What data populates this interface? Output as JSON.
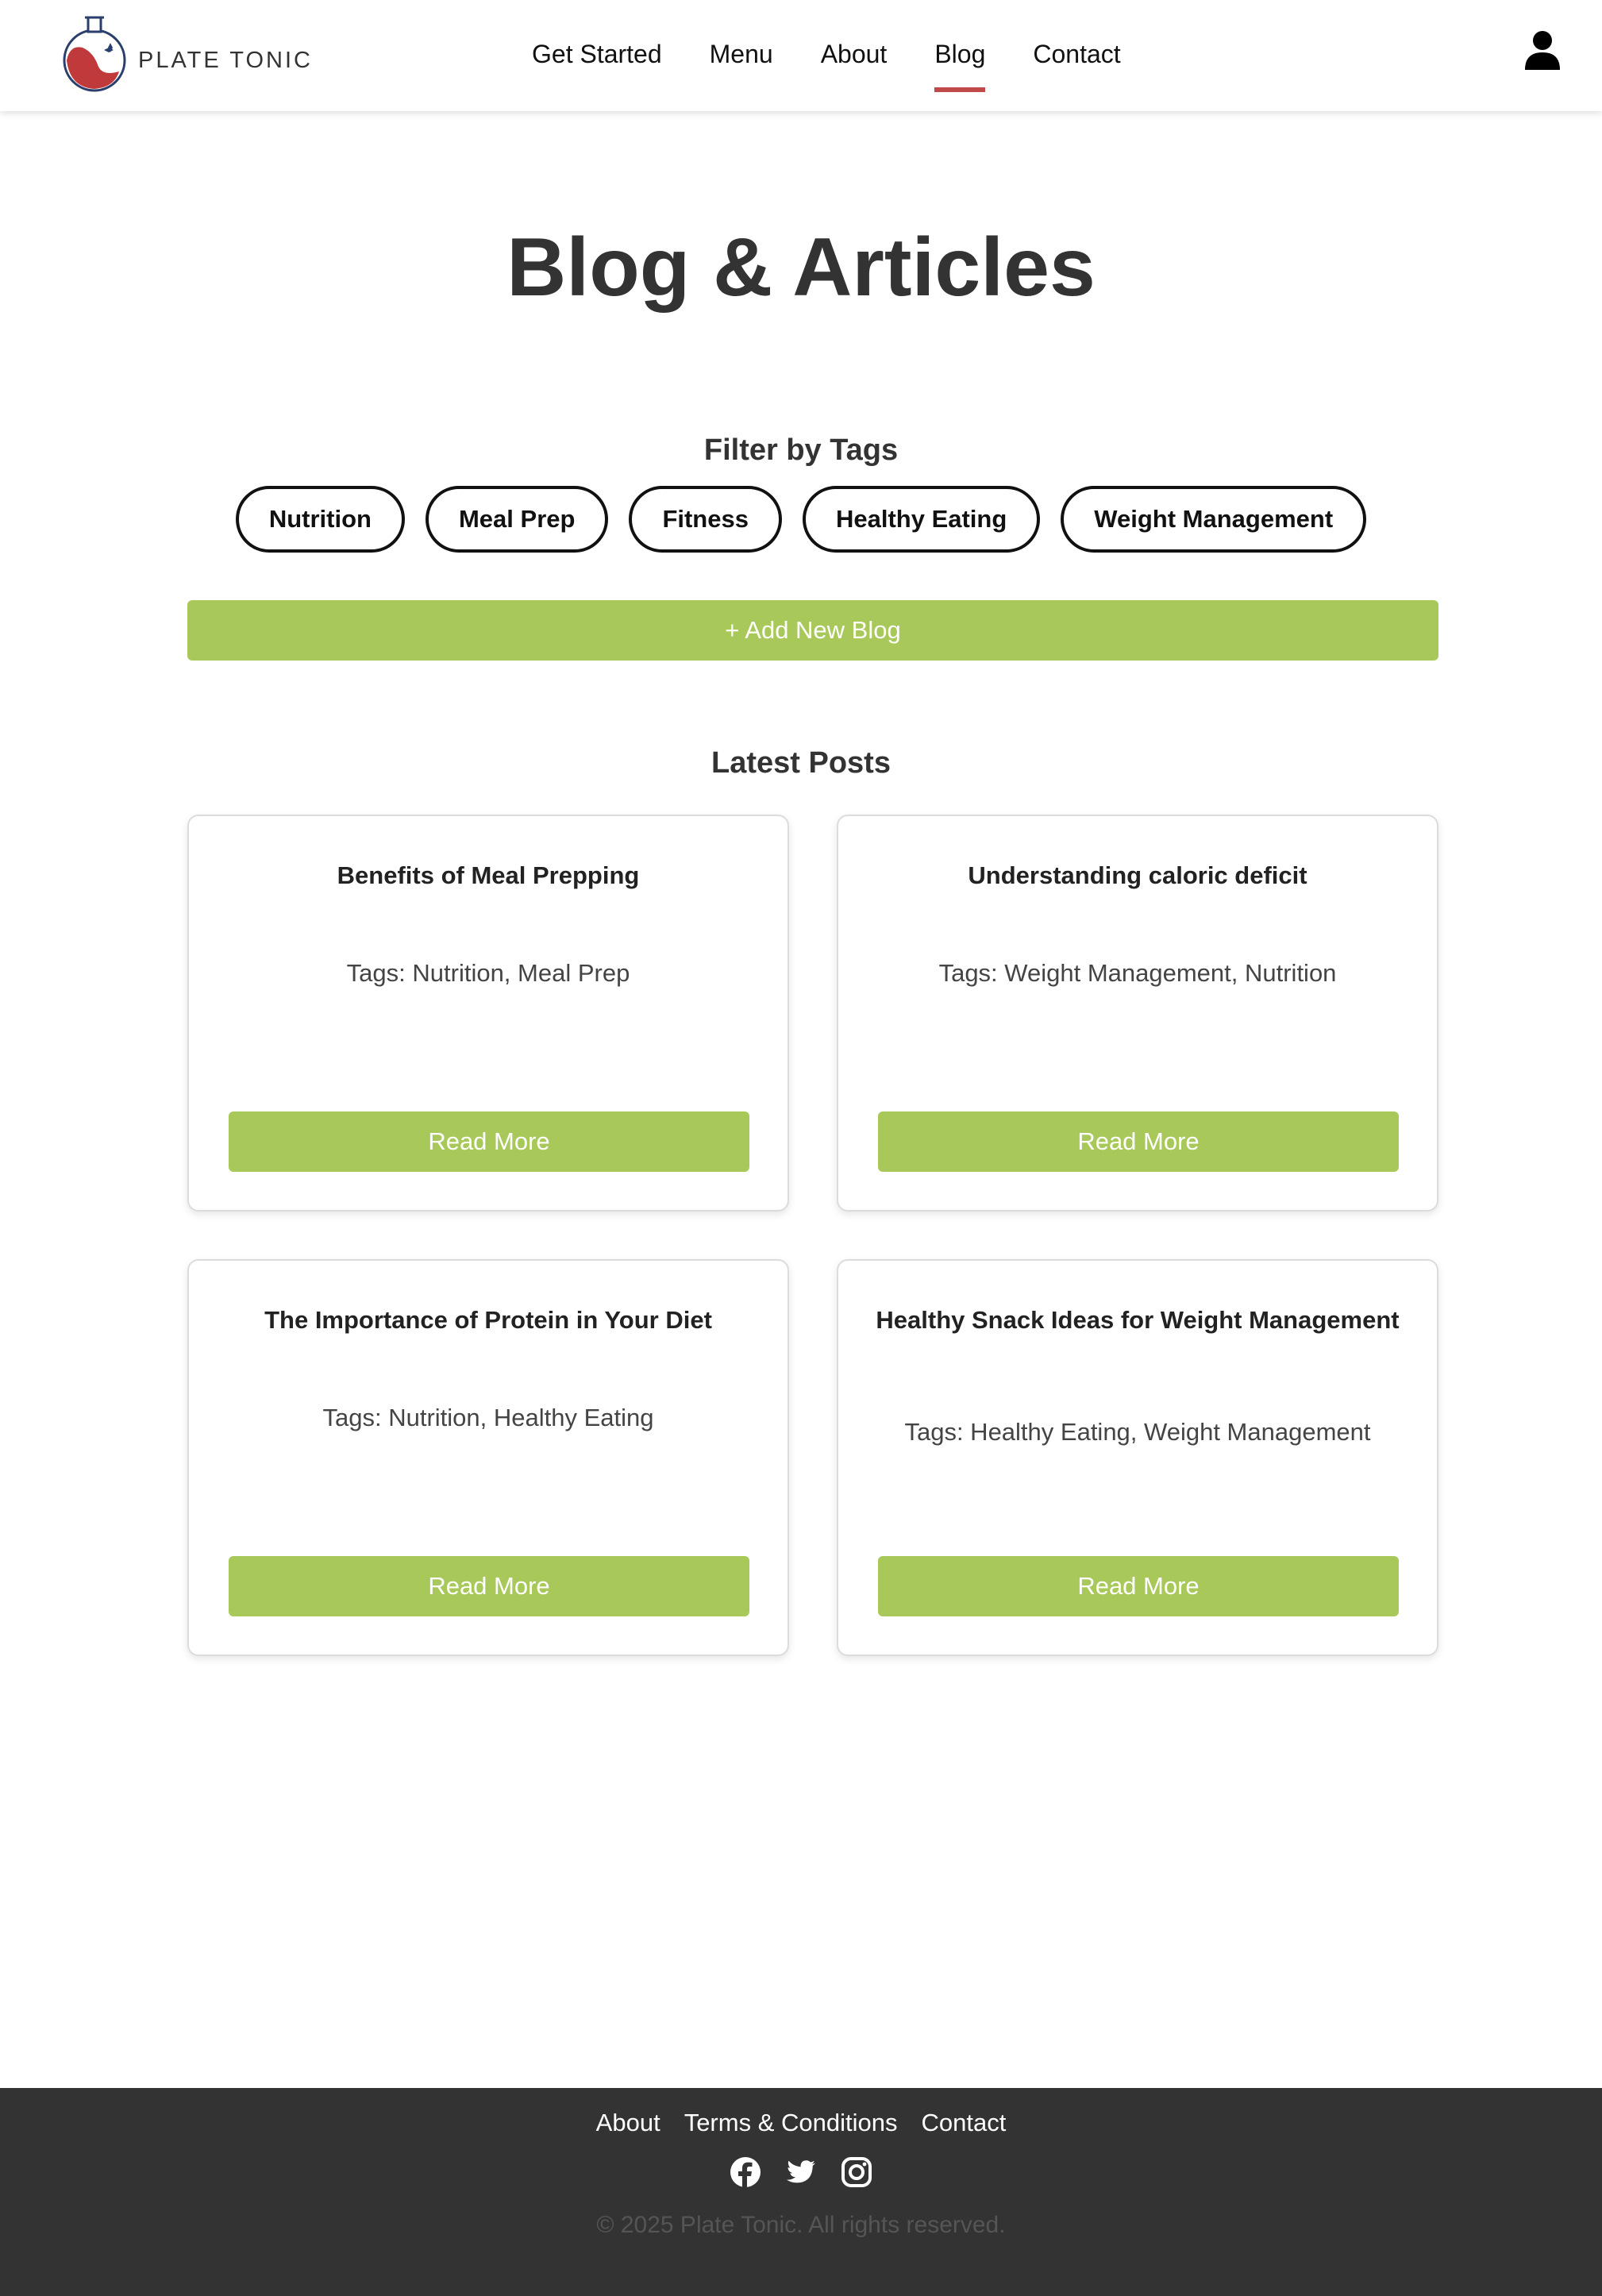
{
  "header": {
    "brand": "PLATE TONIC",
    "nav": [
      {
        "label": "Get Started"
      },
      {
        "label": "Menu"
      },
      {
        "label": "About"
      },
      {
        "label": "Blog",
        "active": true
      },
      {
        "label": "Contact"
      }
    ],
    "user_icon": "user-icon"
  },
  "main": {
    "title": "Blog & Articles",
    "filter_title": "Filter by Tags",
    "tags": [
      "Nutrition",
      "Meal Prep",
      "Fitness",
      "Healthy Eating",
      "Weight Management"
    ],
    "add_button": "+ Add New Blog",
    "latest_title": "Latest Posts",
    "posts": [
      {
        "title": "Benefits of Meal Prepping",
        "tags": "Tags: Nutrition, Meal Prep",
        "button": "Read More"
      },
      {
        "title": "Understanding caloric deficit",
        "tags": "Tags: Weight Management, Nutrition",
        "button": "Read More"
      },
      {
        "title": "The Importance of Protein in Your Diet",
        "tags": "Tags: Nutrition, Healthy Eating",
        "button": "Read More"
      },
      {
        "title": "Healthy Snack Ideas for Weight Management",
        "tags": "Tags: Healthy Eating, Weight Management",
        "button": "Read More"
      }
    ]
  },
  "footer": {
    "links": [
      "About",
      "Terms & Conditions",
      "Contact"
    ],
    "socials": [
      "facebook-icon",
      "twitter-icon",
      "instagram-icon"
    ],
    "copyright": "© 2025 Plate Tonic. All rights reserved."
  },
  "colors": {
    "accent_green": "#a8c95a",
    "active_underline": "#c0494a",
    "footer_bg": "#333333",
    "logo_red": "#c0393b",
    "logo_navy": "#2a3f6b"
  }
}
